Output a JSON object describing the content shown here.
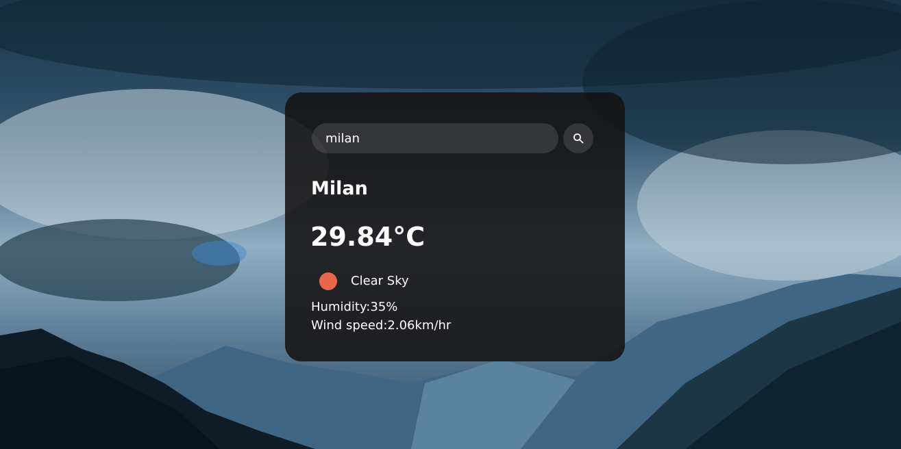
{
  "search": {
    "value": "milan",
    "placeholder": "",
    "button_icon": "search-icon"
  },
  "weather": {
    "city": "Milan",
    "temperature": "29.84°C",
    "condition_icon": "sun-icon",
    "condition_color": "#e8674a",
    "condition": "Clear Sky",
    "humidity": "Humidity:35%",
    "wind": "Wind speed:2.06km/hr"
  }
}
